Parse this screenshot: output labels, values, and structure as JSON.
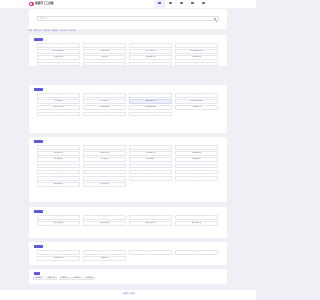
{
  "header": {
    "logo_text": "便捷开工工具箱",
    "nav": [
      {
        "label": "首页",
        "active": true
      },
      {
        "label": "工具",
        "active": false
      },
      {
        "label": "分类",
        "active": false
      },
      {
        "label": "我的",
        "active": false
      },
      {
        "label": "登录",
        "active": false
      }
    ]
  },
  "search": {
    "placeholder": "搜索工具..."
  },
  "breadcrumb": [
    "首页",
    "图片工具",
    "文档工具",
    "开发工具",
    "设计工具",
    "办公工具"
  ],
  "panels": [
    {
      "title": "热门工具",
      "items": [
        "图片格式转换",
        "图片在线压缩",
        "PDF转换工具",
        "视频MP4工具",
        "图片在线批量处理",
        "二维码生成器",
        "图片水印添加",
        "PPT在线编辑工具",
        "音频格式转换",
        "在线文档",
        "视频剪辑工具",
        "PDF编辑工具",
        "PPT模板大全",
        "在线表格工具",
        "GIF动图制作",
        "在线视频工具"
      ]
    },
    {
      "title": "开发工具",
      "items": [
        "颜色选择器",
        "正则表达式",
        "在线图片压缩",
        "JSON格式化",
        "时间戳转换",
        "代码格式化",
        "Md5加密工具",
        "Base64编码转换",
        "Html转义工具",
        "URL编码转换",
        "JavaScript压缩",
        "CSS压缩工具",
        "二维码在线生成",
        "UUID生成器",
        "Markdown编辑器"
      ],
      "highlight_index": 6
    },
    {
      "title": "文档工具",
      "items": [
        "PDF转Word工具",
        "Word转PDF工具",
        "在线编辑PDF",
        "图片转PDF",
        "PDF合并工具",
        "PDF拆分工具",
        "PDF加密工具",
        "PDF压缩工具",
        "Excel转PDF",
        "PPT转PDF",
        "PDF转图片",
        "PDF转Excel",
        "在线Word编辑",
        "Word字数统计",
        "在线文档转换",
        "文档翻译工具",
        "图片文字识别",
        "TXT转PDF",
        "PDF页面删除",
        "PDF页面排序",
        "PDF水印添加",
        "在线签名工具",
        "文档格式转换",
        "在线表格编辑",
        "在线简历制作",
        "电子发票合并"
      ]
    },
    {
      "title": "图片工具",
      "items": [
        "在线抠图工具",
        "证件照制作",
        "图片尺寸修改",
        "图片加水印",
        "照片修复工具",
        "图片格式转换",
        "图片裁剪工具",
        "图片拼接工具"
      ]
    },
    {
      "title": "视频工具",
      "items": [
        "视频格式转换",
        "视频去水印工具",
        "视频压缩工具",
        "视频剪辑工具",
        "在线录屏工具",
        "视频转GIF"
      ]
    }
  ],
  "tags": [
    "热门推荐",
    "最新工具",
    "免费工具",
    "在线工具",
    "实用工具"
  ],
  "footer": {
    "text": "© 便捷开工工具箱"
  }
}
